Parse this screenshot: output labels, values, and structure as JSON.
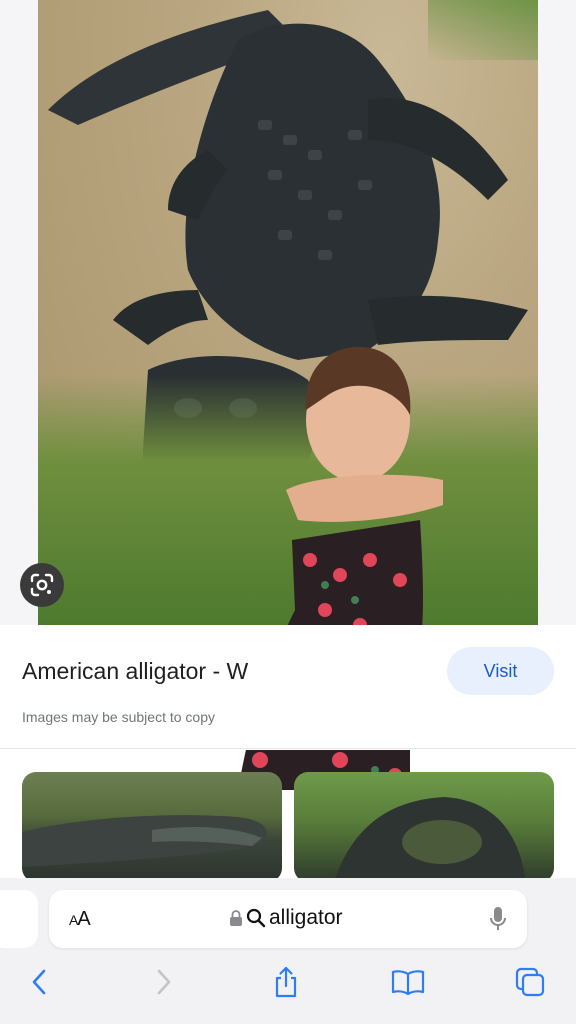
{
  "result": {
    "title": "American alligator - W",
    "note": "Images may be subject to copy",
    "visit_label": "Visit"
  },
  "browser": {
    "aa_label_small": "A",
    "aa_label_large": "A",
    "address_text": "alligator"
  },
  "icons": {
    "lens": "google-lens-icon",
    "lock": "lock-icon",
    "search": "search-icon",
    "mic": "microphone-icon",
    "back": "chevron-left-icon",
    "forward": "chevron-right-icon",
    "share": "share-icon",
    "bookmarks": "book-icon",
    "tabs": "tabs-icon"
  },
  "colors": {
    "accent": "#1a5bc7",
    "visit_bg": "#e8f0fe",
    "toolbar_icons": "#2f7df6"
  }
}
